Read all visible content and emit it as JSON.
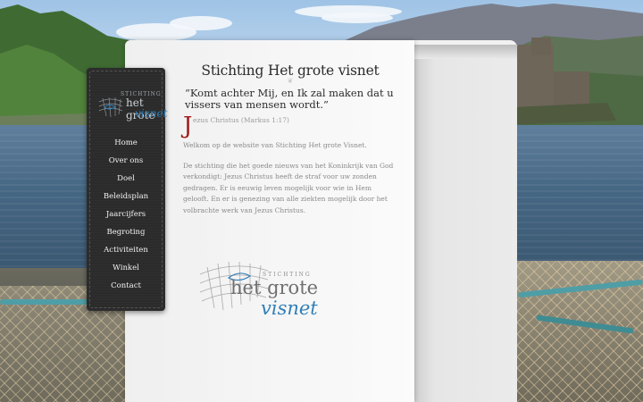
{
  "site": {
    "title": "Stichting Het grote visnet",
    "logo_small": {
      "line1": "STICHTING",
      "line2": "het grote",
      "line3": "visnet"
    },
    "logo_large": {
      "line1": "STICHTING",
      "line2": "het grote",
      "line3": "visnet"
    }
  },
  "nav": {
    "items": [
      {
        "label": "Home"
      },
      {
        "label": "Over ons"
      },
      {
        "label": "Doel"
      },
      {
        "label": "Beleidsplan"
      },
      {
        "label": "Jaarcijfers"
      },
      {
        "label": "Begroting"
      },
      {
        "label": "Activiteiten"
      },
      {
        "label": "Winkel"
      },
      {
        "label": "Contact"
      }
    ]
  },
  "main": {
    "quote": "“Komt achter Mij, en Ik zal maken dat u vissers van mensen wordt.”",
    "attribution_initial": "J",
    "attribution_rest": "ezus Christus (Markus 1:17)",
    "paragraph1": "Welkom op de website van Stichting Het grote Visnet.",
    "paragraph2": "De stichting die het goede nieuws van het Koninkrijk van God verkondigt: Jezus Christus heeft de straf voor uw zonden gedragen. Er is eeuwig leven mogelijk voor wie in Hem gelooft. En er is genezing van alle ziekten mogelijk door het volbrachte werk van Jezus Christus."
  },
  "colors": {
    "accent_red": "#a11d1d",
    "brand_blue": "#2f7fb8",
    "nav_bg": "#2b2b2b"
  }
}
